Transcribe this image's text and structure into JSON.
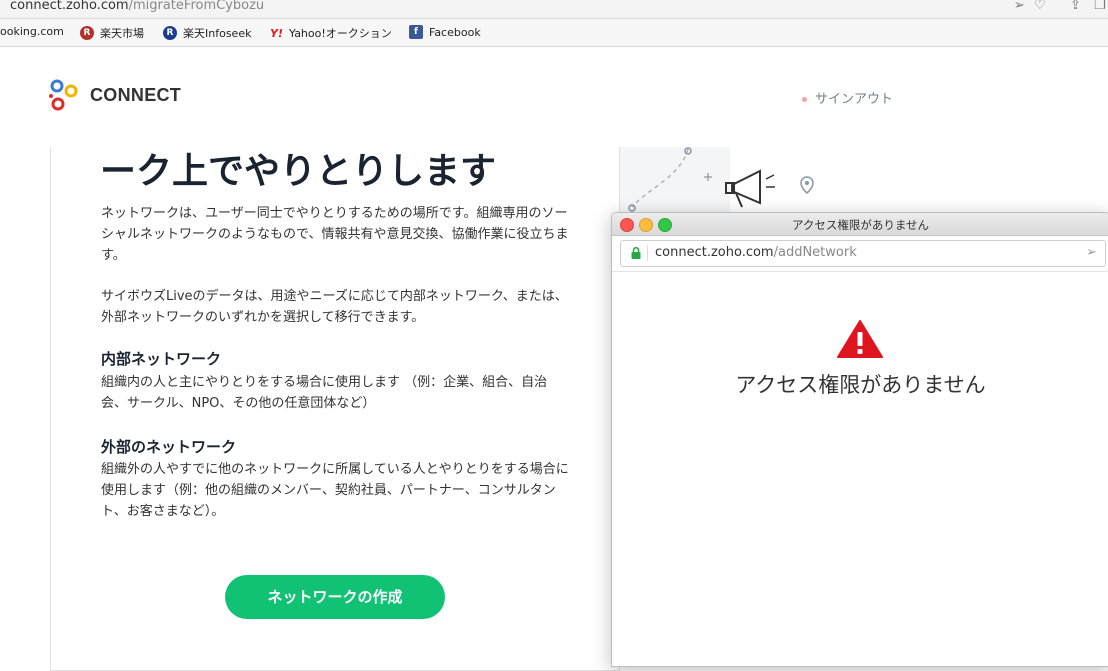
{
  "browser": {
    "url_host": "connect.zoho.com",
    "url_path": "/migrateFromCybozu",
    "bookmarks": [
      {
        "label": "ooking.com",
        "icon": "none"
      },
      {
        "label": "楽天市場",
        "icon": "R",
        "color": "#b5302a"
      },
      {
        "label": "楽天Infoseek",
        "icon": "R",
        "color": "#1d3e8c"
      },
      {
        "label": "Yahoo!オークション",
        "icon": "Y!",
        "color": "#e0201c"
      },
      {
        "label": "Facebook",
        "icon": "f",
        "color": "#3b5998"
      }
    ]
  },
  "header": {
    "logo_text": "CONNECT",
    "signout_label": "サインアウト"
  },
  "main": {
    "heading": "ーク上でやりとりします",
    "intro_1": "ネットワークは、ユーザー同士でやりとりするための場所です。組織専用のソーシャルネットワークのようなもので、情報共有や意見交換、協働作業に役立ちます。",
    "intro_2": "サイボウズLiveのデータは、用途やニーズに応じて内部ネットワーク、または、外部ネットワークのいずれかを選択して移行できます。",
    "internal_title": "内部ネットワーク",
    "internal_desc": "組織内の人と主にやりとりをする場合に使用します （例：企業、組合、自治会、サークル、NPO、その他の任意団体など）",
    "external_title": "外部のネットワーク",
    "external_desc": "組織外の人やすでに他のネットワークに所属している人とやりとりをする場合に使用します（例：他の組織のメンバー、契約社員、パートナー、コンサルタント、お客さまなど）。",
    "create_button": "ネットワークの作成"
  },
  "popup": {
    "title": "アクセス権限がありません",
    "url_host": "connect.zoho.com",
    "url_path": "/addNetwork",
    "message": "アクセス権限がありません",
    "colors": {
      "close": "#fc5753",
      "minimize": "#fdbc40",
      "zoom": "#33c748",
      "warning": "#e0141e",
      "secure": "#28a745"
    }
  },
  "theme": {
    "accent": "#12c274"
  }
}
